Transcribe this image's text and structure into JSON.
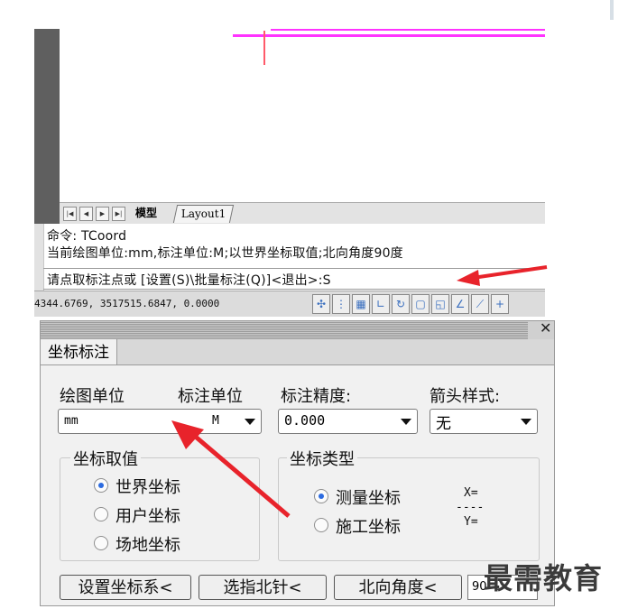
{
  "colors": {
    "accent_red": "#e8232b",
    "magenta_line": "#ff33ff",
    "radio_selected": "#2c6be0"
  },
  "cad": {
    "tabs": {
      "nav_icons": [
        "first-tab-icon",
        "prev-tab-icon",
        "next-tab-icon",
        "last-tab-icon"
      ],
      "model": "模型",
      "layout1": "Layout1"
    },
    "command_lines": [
      "命令: TCoord",
      "当前绘图单位:mm,标注单位:M;以世界坐标取值;北向角度90度"
    ],
    "prompt": "请点取标注点或 [设置(S)\\批量标注(Q)]<退出>:S",
    "status": {
      "coordinates": "4344.6769, 3517515.6847, 0.0000"
    }
  },
  "dialog": {
    "tab_label": "坐标标注",
    "labels": {
      "drawing_unit": "绘图单位",
      "annotation_unit": "标注单位",
      "precision": "标注精度:",
      "arrow_style": "箭头样式:"
    },
    "combos": {
      "units_left": "mm",
      "units_right": "M",
      "precision": "0.000",
      "arrow": "无"
    },
    "coord_source": {
      "title": "坐标取值",
      "options": [
        {
          "label": "世界坐标",
          "selected": true
        },
        {
          "label": "用户坐标",
          "selected": false
        },
        {
          "label": "场地坐标",
          "selected": false
        }
      ]
    },
    "coord_type": {
      "title": "坐标类型",
      "options": [
        {
          "label": "测量坐标",
          "selected": true
        },
        {
          "label": "施工坐标",
          "selected": false
        }
      ],
      "preview": {
        "x": "X=",
        "sep": "----",
        "y": "Y="
      }
    },
    "buttons": {
      "set_coord_system": "设置坐标系<",
      "pick_north": "选指北针<",
      "north_angle": "北向角度<"
    },
    "angle_value": "90"
  },
  "watermark": "最需教育"
}
